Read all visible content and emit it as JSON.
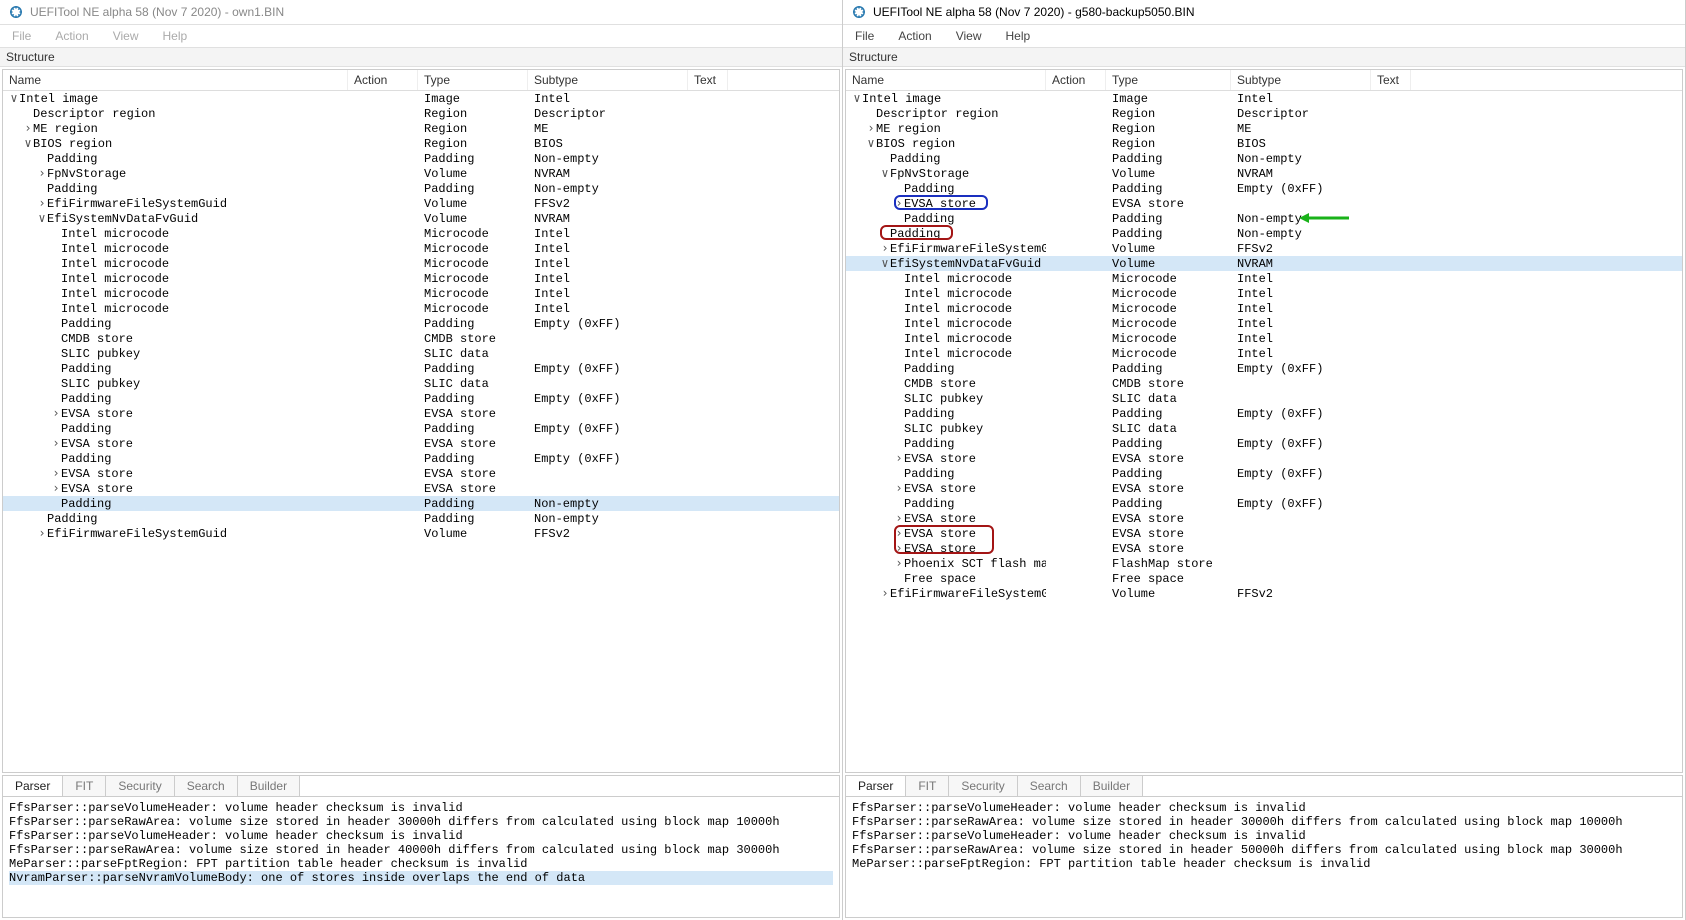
{
  "app_name": "UEFITool NE alpha 58 (Nov  7 2020)",
  "left": {
    "title_file": "own1.BIN",
    "active": false
  },
  "right": {
    "title_file": "g580-backup5050.BIN",
    "active": true
  },
  "menus": [
    "File",
    "Action",
    "View",
    "Help"
  ],
  "structure_label": "Structure",
  "columns": {
    "name": "Name",
    "action": "Action",
    "type": "Type",
    "subtype": "Subtype",
    "text": "Text"
  },
  "col_widths_left": {
    "name": 345,
    "action": 70,
    "type": 110,
    "subtype": 160,
    "text": 40
  },
  "col_widths_right": {
    "name": 200,
    "action": 60,
    "type": 125,
    "subtype": 140,
    "text": 40
  },
  "tree_left": [
    {
      "indent": 0,
      "toggle": "v",
      "name": "Intel image",
      "type": "Image",
      "subtype": "Intel"
    },
    {
      "indent": 1,
      "toggle": " ",
      "name": "Descriptor region",
      "type": "Region",
      "subtype": "Descriptor"
    },
    {
      "indent": 1,
      "toggle": ">",
      "name": "ME region",
      "type": "Region",
      "subtype": "ME"
    },
    {
      "indent": 1,
      "toggle": "v",
      "name": "BIOS region",
      "type": "Region",
      "subtype": "BIOS"
    },
    {
      "indent": 2,
      "toggle": " ",
      "name": "Padding",
      "type": "Padding",
      "subtype": "Non-empty"
    },
    {
      "indent": 2,
      "toggle": ">",
      "name": "FpNvStorage",
      "type": "Volume",
      "subtype": "NVRAM"
    },
    {
      "indent": 2,
      "toggle": " ",
      "name": "Padding",
      "type": "Padding",
      "subtype": "Non-empty"
    },
    {
      "indent": 2,
      "toggle": ">",
      "name": "EfiFirmwareFileSystemGuid",
      "type": "Volume",
      "subtype": "FFSv2"
    },
    {
      "indent": 2,
      "toggle": "v",
      "name": "EfiSystemNvDataFvGuid",
      "type": "Volume",
      "subtype": "NVRAM"
    },
    {
      "indent": 3,
      "toggle": " ",
      "name": "Intel microcode",
      "type": "Microcode",
      "subtype": "Intel"
    },
    {
      "indent": 3,
      "toggle": " ",
      "name": "Intel microcode",
      "type": "Microcode",
      "subtype": "Intel"
    },
    {
      "indent": 3,
      "toggle": " ",
      "name": "Intel microcode",
      "type": "Microcode",
      "subtype": "Intel"
    },
    {
      "indent": 3,
      "toggle": " ",
      "name": "Intel microcode",
      "type": "Microcode",
      "subtype": "Intel"
    },
    {
      "indent": 3,
      "toggle": " ",
      "name": "Intel microcode",
      "type": "Microcode",
      "subtype": "Intel"
    },
    {
      "indent": 3,
      "toggle": " ",
      "name": "Intel microcode",
      "type": "Microcode",
      "subtype": "Intel"
    },
    {
      "indent": 3,
      "toggle": " ",
      "name": "Padding",
      "type": "Padding",
      "subtype": "Empty (0xFF)"
    },
    {
      "indent": 3,
      "toggle": " ",
      "name": "CMDB store",
      "type": "CMDB store",
      "subtype": ""
    },
    {
      "indent": 3,
      "toggle": " ",
      "name": "SLIC pubkey",
      "type": "SLIC data",
      "subtype": ""
    },
    {
      "indent": 3,
      "toggle": " ",
      "name": "Padding",
      "type": "Padding",
      "subtype": "Empty (0xFF)"
    },
    {
      "indent": 3,
      "toggle": " ",
      "name": "SLIC pubkey",
      "type": "SLIC data",
      "subtype": ""
    },
    {
      "indent": 3,
      "toggle": " ",
      "name": "Padding",
      "type": "Padding",
      "subtype": "Empty (0xFF)"
    },
    {
      "indent": 3,
      "toggle": ">",
      "name": "EVSA store",
      "type": "EVSA store",
      "subtype": ""
    },
    {
      "indent": 3,
      "toggle": " ",
      "name": "Padding",
      "type": "Padding",
      "subtype": "Empty (0xFF)"
    },
    {
      "indent": 3,
      "toggle": ">",
      "name": "EVSA store",
      "type": "EVSA store",
      "subtype": ""
    },
    {
      "indent": 3,
      "toggle": " ",
      "name": "Padding",
      "type": "Padding",
      "subtype": "Empty (0xFF)"
    },
    {
      "indent": 3,
      "toggle": ">",
      "name": "EVSA store",
      "type": "EVSA store",
      "subtype": ""
    },
    {
      "indent": 3,
      "toggle": ">",
      "name": "EVSA store",
      "type": "EVSA store",
      "subtype": ""
    },
    {
      "indent": 3,
      "toggle": " ",
      "name": "Padding",
      "type": "Padding",
      "subtype": "Non-empty",
      "selected": true
    },
    {
      "indent": 2,
      "toggle": " ",
      "name": "Padding",
      "type": "Padding",
      "subtype": "Non-empty"
    },
    {
      "indent": 2,
      "toggle": ">",
      "name": "EfiFirmwareFileSystemGuid",
      "type": "Volume",
      "subtype": "FFSv2"
    }
  ],
  "tree_right": [
    {
      "indent": 0,
      "toggle": "v",
      "name": "Intel image",
      "type": "Image",
      "subtype": "Intel"
    },
    {
      "indent": 1,
      "toggle": " ",
      "name": "Descriptor region",
      "type": "Region",
      "subtype": "Descriptor"
    },
    {
      "indent": 1,
      "toggle": ">",
      "name": "ME region",
      "type": "Region",
      "subtype": "ME"
    },
    {
      "indent": 1,
      "toggle": "v",
      "name": "BIOS region",
      "type": "Region",
      "subtype": "BIOS"
    },
    {
      "indent": 2,
      "toggle": " ",
      "name": "Padding",
      "type": "Padding",
      "subtype": "Non-empty"
    },
    {
      "indent": 2,
      "toggle": "v",
      "name": "FpNvStorage",
      "type": "Volume",
      "subtype": "NVRAM"
    },
    {
      "indent": 3,
      "toggle": " ",
      "name": "Padding",
      "type": "Padding",
      "subtype": "Empty (0xFF)"
    },
    {
      "indent": 3,
      "toggle": ">",
      "name": "EVSA store",
      "type": "EVSA store",
      "subtype": "",
      "annot": "blue"
    },
    {
      "indent": 3,
      "toggle": " ",
      "name": "Padding",
      "type": "Padding",
      "subtype": "Non-empty",
      "arrow": true
    },
    {
      "indent": 2,
      "toggle": " ",
      "name": "Padding",
      "type": "Padding",
      "subtype": "Non-empty",
      "annot": "red"
    },
    {
      "indent": 2,
      "toggle": ">",
      "name": "EfiFirmwareFileSystemGuid",
      "type": "Volume",
      "subtype": "FFSv2"
    },
    {
      "indent": 2,
      "toggle": "v",
      "name": "EfiSystemNvDataFvGuid",
      "type": "Volume",
      "subtype": "NVRAM",
      "selected": true
    },
    {
      "indent": 3,
      "toggle": " ",
      "name": "Intel microcode",
      "type": "Microcode",
      "subtype": "Intel"
    },
    {
      "indent": 3,
      "toggle": " ",
      "name": "Intel microcode",
      "type": "Microcode",
      "subtype": "Intel"
    },
    {
      "indent": 3,
      "toggle": " ",
      "name": "Intel microcode",
      "type": "Microcode",
      "subtype": "Intel"
    },
    {
      "indent": 3,
      "toggle": " ",
      "name": "Intel microcode",
      "type": "Microcode",
      "subtype": "Intel"
    },
    {
      "indent": 3,
      "toggle": " ",
      "name": "Intel microcode",
      "type": "Microcode",
      "subtype": "Intel"
    },
    {
      "indent": 3,
      "toggle": " ",
      "name": "Intel microcode",
      "type": "Microcode",
      "subtype": "Intel"
    },
    {
      "indent": 3,
      "toggle": " ",
      "name": "Padding",
      "type": "Padding",
      "subtype": "Empty (0xFF)"
    },
    {
      "indent": 3,
      "toggle": " ",
      "name": "CMDB store",
      "type": "CMDB store",
      "subtype": ""
    },
    {
      "indent": 3,
      "toggle": " ",
      "name": "SLIC pubkey",
      "type": "SLIC data",
      "subtype": ""
    },
    {
      "indent": 3,
      "toggle": " ",
      "name": "Padding",
      "type": "Padding",
      "subtype": "Empty (0xFF)"
    },
    {
      "indent": 3,
      "toggle": " ",
      "name": "SLIC pubkey",
      "type": "SLIC data",
      "subtype": ""
    },
    {
      "indent": 3,
      "toggle": " ",
      "name": "Padding",
      "type": "Padding",
      "subtype": "Empty (0xFF)"
    },
    {
      "indent": 3,
      "toggle": ">",
      "name": "EVSA store",
      "type": "EVSA store",
      "subtype": ""
    },
    {
      "indent": 3,
      "toggle": " ",
      "name": "Padding",
      "type": "Padding",
      "subtype": "Empty (0xFF)"
    },
    {
      "indent": 3,
      "toggle": ">",
      "name": "EVSA store",
      "type": "EVSA store",
      "subtype": ""
    },
    {
      "indent": 3,
      "toggle": " ",
      "name": "Padding",
      "type": "Padding",
      "subtype": "Empty (0xFF)"
    },
    {
      "indent": 3,
      "toggle": ">",
      "name": "EVSA store",
      "type": "EVSA store",
      "subtype": ""
    },
    {
      "indent": 3,
      "toggle": ">",
      "name": "EVSA store",
      "type": "EVSA store",
      "subtype": "",
      "annot": "red"
    },
    {
      "indent": 3,
      "toggle": ">",
      "name": "EVSA store",
      "type": "EVSA store",
      "subtype": "",
      "annot": "red"
    },
    {
      "indent": 3,
      "toggle": ">",
      "name": "Phoenix SCT flash map",
      "type": "FlashMap store",
      "subtype": ""
    },
    {
      "indent": 3,
      "toggle": " ",
      "name": "Free space",
      "type": "Free space",
      "subtype": ""
    },
    {
      "indent": 2,
      "toggle": ">",
      "name": "EfiFirmwareFileSystemGuid",
      "type": "Volume",
      "subtype": "FFSv2"
    }
  ],
  "tabs": [
    "Parser",
    "FIT",
    "Security",
    "Search",
    "Builder"
  ],
  "active_tab": 0,
  "log_left": [
    "FfsParser::parseVolumeHeader: volume header checksum is invalid",
    "FfsParser::parseRawArea: volume size stored in header 30000h differs from calculated using block map 10000h",
    "FfsParser::parseVolumeHeader: volume header checksum is invalid",
    "FfsParser::parseRawArea: volume size stored in header 40000h differs from calculated using block map 30000h",
    "MeParser::parseFptRegion: FPT partition table header checksum is invalid",
    "NvramParser::parseNvramVolumeBody: one of stores inside overlaps the end of data"
  ],
  "log_left_highlight": 5,
  "log_right": [
    "FfsParser::parseVolumeHeader: volume header checksum is invalid",
    "FfsParser::parseRawArea: volume size stored in header 30000h differs from calculated using block map 10000h",
    "FfsParser::parseVolumeHeader: volume header checksum is invalid",
    "FfsParser::parseRawArea: volume size stored in header 50000h differs from calculated using block map 30000h",
    "MeParser::parseFptRegion: FPT partition table header checksum is invalid"
  ]
}
